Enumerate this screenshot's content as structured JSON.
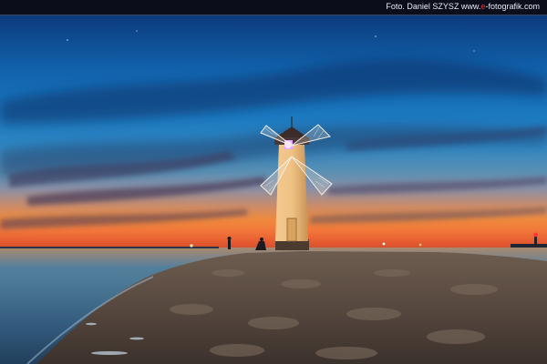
{
  "credit": {
    "prefix": "Foto. Daniel SZYSZ www.",
    "accent": "e",
    "suffix": "-fotografik.com"
  },
  "colors": {
    "sky_top": "#0c3a7c",
    "horizon_glow": "#ef8a3e",
    "tower": "#efc284",
    "window_glow": "#e6a7ff",
    "sea": "#4c7996",
    "pier": "#5e5046",
    "credit_accent": "#e0313a"
  },
  "icons": {
    "windmill": "windmill-icon",
    "light": "navigation-light-icon"
  }
}
